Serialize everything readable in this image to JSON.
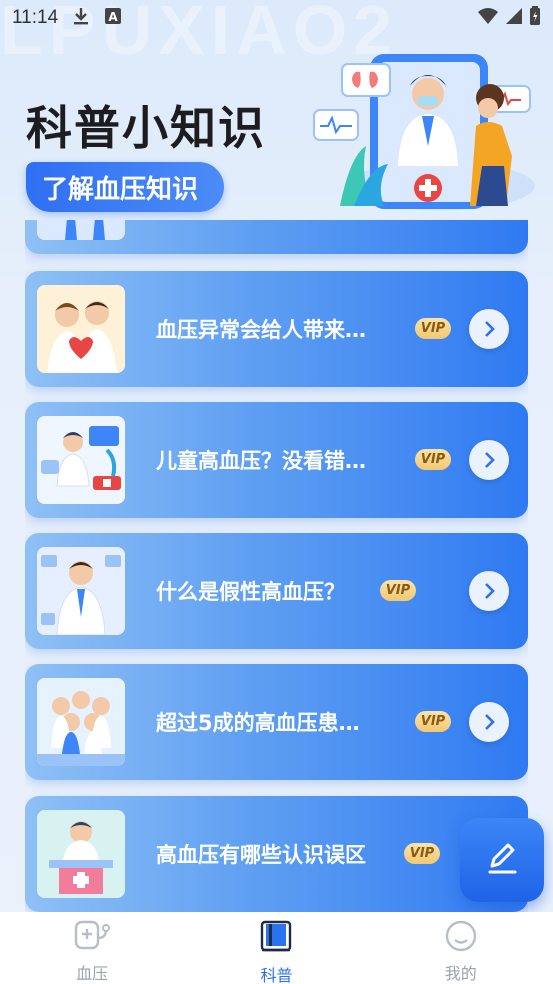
{
  "status_bar": {
    "time": "11:14"
  },
  "watermark": "LPUXIAO2",
  "header": {
    "title": "科普小知识",
    "subtitle": "了解血压知识"
  },
  "cards": [
    {
      "title": "血压异常会给人带来…",
      "vip": "VIP"
    },
    {
      "title": "儿童高血压？没看错…",
      "vip": "VIP"
    },
    {
      "title": "什么是假性高血压？",
      "vip": "VIP"
    },
    {
      "title": "超过5成的高血压患…",
      "vip": "VIP"
    },
    {
      "title": "高血压有哪些认识误区",
      "vip": "VIP"
    }
  ],
  "tabbar": {
    "tabs": [
      {
        "label": "血压",
        "icon": "stethoscope-icon"
      },
      {
        "label": "科普",
        "icon": "book-icon"
      },
      {
        "label": "我的",
        "icon": "smile-icon"
      }
    ],
    "active_color": "#2b72f0"
  },
  "fab": {
    "icon": "edit-pen-icon"
  }
}
